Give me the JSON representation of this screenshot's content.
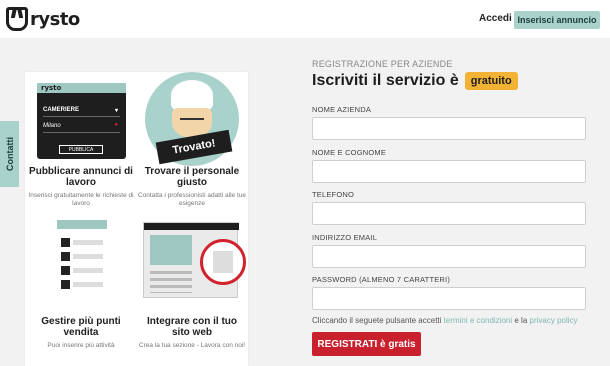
{
  "header": {
    "logo_text": "rysto",
    "login_label": "Accedi",
    "post_ad_label": "Inserisci annuncio"
  },
  "side_tab": {
    "label": "Contatti"
  },
  "features": [
    {
      "title": "Pubblicare annunci di lavoro",
      "desc": "Inserisci gratuitamente le richieste di lavoro"
    },
    {
      "title": "Trovare il personale giusto",
      "desc": "Contatta i professionisti adatti alle tue esigenze"
    },
    {
      "title": "Gestire più punti vendita",
      "desc": "Puoi inserire più attività"
    },
    {
      "title": "Integrare con il tuo sito web",
      "desc": "Crea la tua sezione - Lavora con noi!"
    }
  ],
  "illustrations": {
    "phone": {
      "logo": "rysto",
      "job": "CAMERIERE",
      "city": "Milano",
      "button": "PUBBLICA"
    },
    "chef_banner": "Trovato!"
  },
  "form": {
    "subtitle": "REGISTRAZIONE PER AZIENDE",
    "title": "Iscriviti il servizio è",
    "title_badge": "gratuito",
    "fields": [
      {
        "label": "NOME AZIENDA",
        "value": ""
      },
      {
        "label": "NOME E COGNOME",
        "value": ""
      },
      {
        "label": "TELEFONO",
        "value": ""
      },
      {
        "label": "INDIRIZZO EMAIL",
        "value": ""
      },
      {
        "label": "PASSWORD (ALMENO 7 CARATTERI)",
        "value": ""
      }
    ],
    "terms_prefix": "Cliccando il seguete pulsante accetti",
    "terms_link": "termini e condizioni",
    "terms_and": "e la",
    "privacy_link": "privacy policy",
    "submit_label": "REGISTRATI è gratis"
  },
  "colors": {
    "accent_teal": "#a9d2cc",
    "badge_yellow": "#f2b233",
    "cta_red": "#c8202c"
  }
}
